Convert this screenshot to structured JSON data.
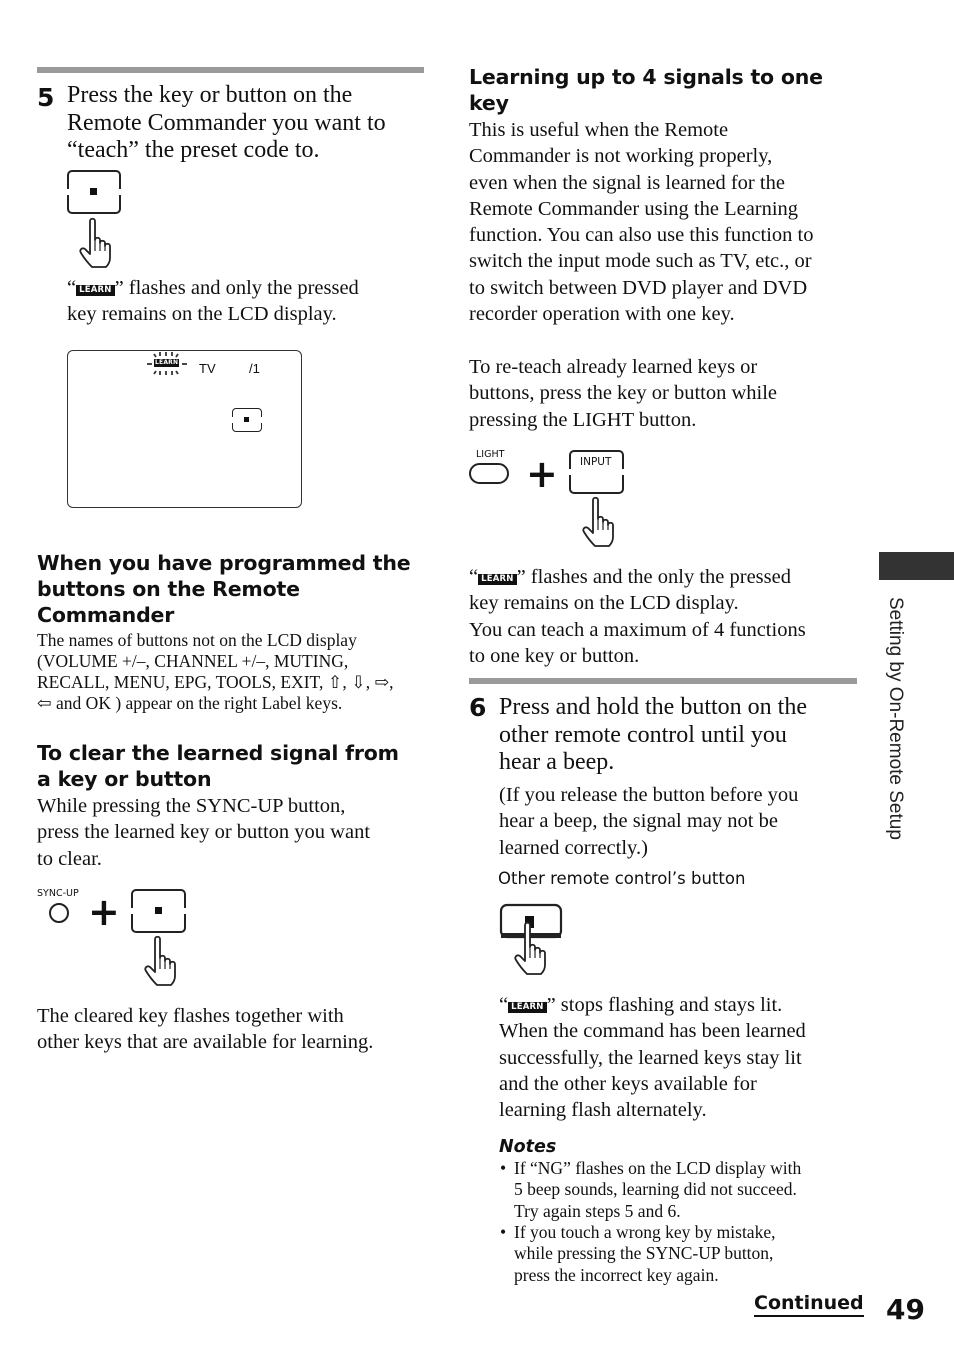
{
  "page": {
    "number": "49",
    "continued_label": "Continued",
    "side_tab_label": "Setting by On-Remote Setup"
  },
  "left_column": {
    "step5": {
      "number": "5",
      "lines": [
        "Press the key or button on the",
        "Remote Commander you want to",
        "“teach” the preset code to."
      ],
      "learn_note": {
        "open_quote": "“",
        "badge": "LEARN",
        "rest_line1": "” flashes and only the pressed",
        "line2": "key remains on the LCD display."
      },
      "lcd": {
        "badge": "LEARN",
        "mode": "TV",
        "index": "/1"
      }
    },
    "programmed_section": {
      "heading_lines": [
        "When you have programmed the",
        "buttons on the Remote",
        "Commander"
      ],
      "body_lines": [
        "The names of buttons not on the LCD display",
        "(VOLUME +/–, CHANNEL +/–, MUTING,",
        "RECALL, MENU, EPG, TOOLS, EXIT, ⇧, ⇩, ⇨,",
        "⇦ and OK ) appear on the right Label keys."
      ]
    },
    "clear_section": {
      "heading_lines": [
        "To clear the learned signal from",
        "a key or button"
      ],
      "body_lines": [
        "While pressing the SYNC-UP button,",
        "press the learned key or button you want",
        "to clear."
      ],
      "sync_up_label": "SYNC-UP",
      "plus": "+",
      "after_lines": [
        "The cleared key flashes together with",
        "other keys that are available for learning."
      ]
    }
  },
  "right_column": {
    "learning_section": {
      "heading_lines": [
        "Learning up to 4 signals to one",
        "key"
      ],
      "body_lines": [
        "This is useful when the Remote",
        "Commander is not working properly,",
        "even when the signal is learned for the",
        "Remote Commander using the Learning",
        "function. You can also use this function to",
        "switch the input mode such as TV, etc., or",
        "to switch between DVD player and DVD",
        "recorder operation with one key."
      ],
      "reteach_lines": [
        "To re-teach already learned keys or",
        "buttons, press the key or button while",
        "pressing the LIGHT button."
      ],
      "light_label": "LIGHT",
      "input_label": "INPUT",
      "plus": "+",
      "learn_note": {
        "open_quote": "“",
        "badge": "LEARN",
        "rest_line1": "” flashes and the only the pressed",
        "line2": "key remains on the LCD display.",
        "line3": "You can teach a maximum of 4 functions",
        "line4": "to one key or button."
      }
    },
    "step6": {
      "number": "6",
      "lines": [
        "Press and hold the button on the",
        "other remote control until you",
        "hear a beep."
      ],
      "paren_lines": [
        "(If you release the button before you",
        "hear a beep, the signal may not be",
        "learned correctly.)"
      ],
      "caption": "Other remote control’s button",
      "result": {
        "open_quote": "“",
        "badge": "LEARN",
        "rest_line1": "” stops flashing and stays lit.",
        "lines": [
          "When the command has been learned",
          "successfully, the learned keys stay lit",
          "and the other keys available for",
          "learning flash alternately."
        ]
      }
    },
    "notes": {
      "title": "Notes",
      "bullet": "•",
      "items": [
        [
          "If “NG” flashes on the LCD display with",
          "5 beep sounds, learning did not succeed.",
          "Try again steps 5 and 6."
        ],
        [
          "If you touch a wrong key by mistake,",
          "while pressing the SYNC-UP button,",
          "press the incorrect key again."
        ]
      ]
    }
  }
}
